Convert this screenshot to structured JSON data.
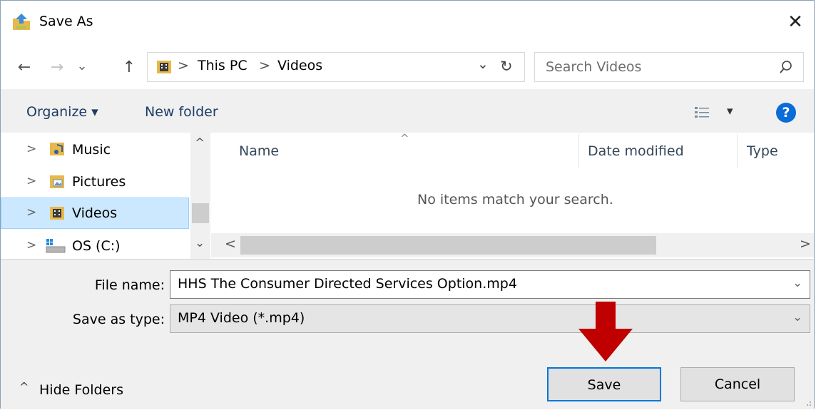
{
  "window": {
    "title": "Save As",
    "close_glyph": "✕"
  },
  "nav": {
    "back": "←",
    "forward": "→",
    "recent": "⌄",
    "up": "↑",
    "breadcrumb": [
      "This PC",
      "Videos"
    ],
    "separator": ">",
    "dropdown": "⌄",
    "refresh": "↻",
    "search_placeholder": "Search Videos"
  },
  "toolbar": {
    "organize": "Organize ▾",
    "new_folder": "New folder",
    "view_dropdown": "▾",
    "help": "?"
  },
  "sidebar": {
    "items": [
      {
        "label": "Music",
        "icon": "music-folder-icon"
      },
      {
        "label": "Pictures",
        "icon": "pictures-folder-icon"
      },
      {
        "label": "Videos",
        "icon": "videos-folder-icon",
        "selected": true
      },
      {
        "label": "OS (C:)",
        "icon": "drive-icon"
      }
    ],
    "expander": ">",
    "scroll_up": "^",
    "scroll_down": "⌄"
  },
  "files": {
    "columns": [
      "Name",
      "Date modified",
      "Type"
    ],
    "sort_indicator": "^",
    "empty_message": "No items match your search.",
    "scroll_left": "<",
    "scroll_right": ">"
  },
  "form": {
    "file_name_label": "File name:",
    "file_name_value": "HHS The Consumer Directed Services Option.mp4",
    "save_type_label": "Save as type:",
    "save_type_value": "MP4 Video (*.mp4)",
    "dropdown": "⌄"
  },
  "footer": {
    "hide_folders": "Hide Folders",
    "hide_glyph": "^",
    "save": "Save",
    "cancel": "Cancel"
  },
  "colors": {
    "selection": "#cce8ff",
    "accent_border": "#0078d7",
    "arrow_red": "#c00000",
    "help_blue": "#0a6cd6",
    "folder_yellow": "#e8b84a"
  }
}
